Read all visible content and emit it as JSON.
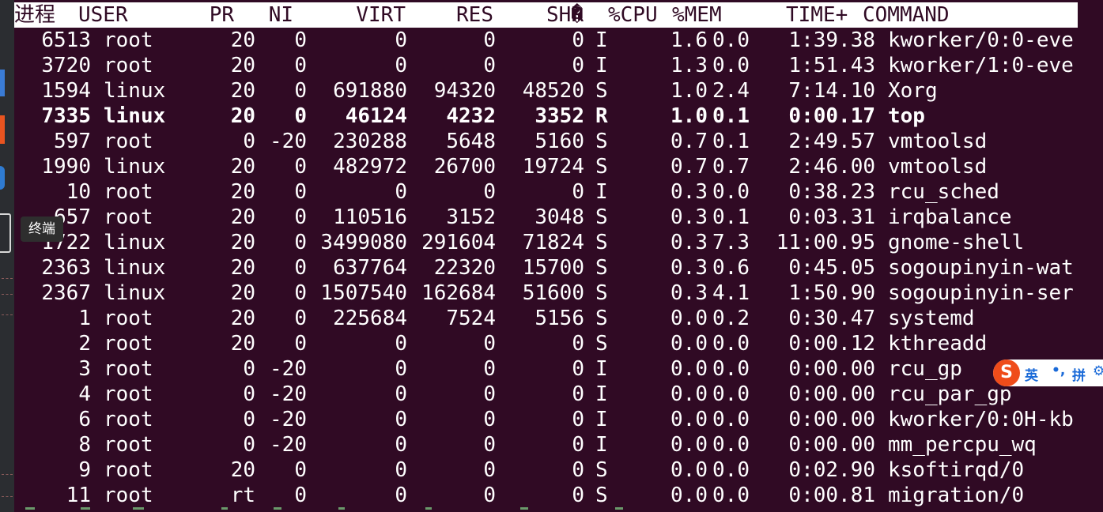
{
  "tooltip": "终端",
  "header": {
    "pid": "进程",
    "user": "USER",
    "pr": "PR",
    "ni": "NI",
    "virt": "VIRT",
    "res": "RES",
    "shr": "SHR",
    "s": "�",
    "cpu": "%CPU",
    "mem": "%MEM",
    "time": "TIME+",
    "command": "COMMAND"
  },
  "processes": [
    {
      "pid": "6513",
      "user": "root",
      "pr": "20",
      "ni": "0",
      "virt": "0",
      "res": "0",
      "shr": "0",
      "s": "I",
      "cpu": "1.6",
      "mem": "0.0",
      "time": "1:39.38",
      "command": "kworker/0:0-eve"
    },
    {
      "pid": "3720",
      "user": "root",
      "pr": "20",
      "ni": "0",
      "virt": "0",
      "res": "0",
      "shr": "0",
      "s": "I",
      "cpu": "1.3",
      "mem": "0.0",
      "time": "1:51.43",
      "command": "kworker/1:0-eve"
    },
    {
      "pid": "1594",
      "user": "linux",
      "pr": "20",
      "ni": "0",
      "virt": "691880",
      "res": "94320",
      "shr": "48520",
      "s": "S",
      "cpu": "1.0",
      "mem": "2.4",
      "time": "7:14.10",
      "command": "Xorg"
    },
    {
      "pid": "7335",
      "user": "linux",
      "pr": "20",
      "ni": "0",
      "virt": "46124",
      "res": "4232",
      "shr": "3352",
      "s": "R",
      "cpu": "1.0",
      "mem": "0.1",
      "time": "0:00.17",
      "command": "top"
    },
    {
      "pid": "597",
      "user": "root",
      "pr": "0",
      "ni": "-20",
      "virt": "230288",
      "res": "5648",
      "shr": "5160",
      "s": "S",
      "cpu": "0.7",
      "mem": "0.1",
      "time": "2:49.57",
      "command": "vmtoolsd"
    },
    {
      "pid": "1990",
      "user": "linux",
      "pr": "20",
      "ni": "0",
      "virt": "482972",
      "res": "26700",
      "shr": "19724",
      "s": "S",
      "cpu": "0.7",
      "mem": "0.7",
      "time": "2:46.00",
      "command": "vmtoolsd"
    },
    {
      "pid": "10",
      "user": "root",
      "pr": "20",
      "ni": "0",
      "virt": "0",
      "res": "0",
      "shr": "0",
      "s": "I",
      "cpu": "0.3",
      "mem": "0.0",
      "time": "0:38.23",
      "command": "rcu_sched"
    },
    {
      "pid": "657",
      "user": "root",
      "pr": "20",
      "ni": "0",
      "virt": "110516",
      "res": "3152",
      "shr": "3048",
      "s": "S",
      "cpu": "0.3",
      "mem": "0.1",
      "time": "0:03.31",
      "command": "irqbalance"
    },
    {
      "pid": "1722",
      "user": "linux",
      "pr": "20",
      "ni": "0",
      "virt": "3499080",
      "res": "291604",
      "shr": "71824",
      "s": "S",
      "cpu": "0.3",
      "mem": "7.3",
      "time": "11:00.95",
      "command": "gnome-shell"
    },
    {
      "pid": "2363",
      "user": "linux",
      "pr": "20",
      "ni": "0",
      "virt": "637764",
      "res": "22320",
      "shr": "15700",
      "s": "S",
      "cpu": "0.3",
      "mem": "0.6",
      "time": "0:45.05",
      "command": "sogoupinyin-wat"
    },
    {
      "pid": "2367",
      "user": "linux",
      "pr": "20",
      "ni": "0",
      "virt": "1507540",
      "res": "162684",
      "shr": "51600",
      "s": "S",
      "cpu": "0.3",
      "mem": "4.1",
      "time": "1:50.90",
      "command": "sogoupinyin-ser"
    },
    {
      "pid": "1",
      "user": "root",
      "pr": "20",
      "ni": "0",
      "virt": "225684",
      "res": "7524",
      "shr": "5156",
      "s": "S",
      "cpu": "0.0",
      "mem": "0.2",
      "time": "0:30.47",
      "command": "systemd"
    },
    {
      "pid": "2",
      "user": "root",
      "pr": "20",
      "ni": "0",
      "virt": "0",
      "res": "0",
      "shr": "0",
      "s": "S",
      "cpu": "0.0",
      "mem": "0.0",
      "time": "0:00.12",
      "command": "kthreadd"
    },
    {
      "pid": "3",
      "user": "root",
      "pr": "0",
      "ni": "-20",
      "virt": "0",
      "res": "0",
      "shr": "0",
      "s": "I",
      "cpu": "0.0",
      "mem": "0.0",
      "time": "0:00.00",
      "command": "rcu_gp"
    },
    {
      "pid": "4",
      "user": "root",
      "pr": "0",
      "ni": "-20",
      "virt": "0",
      "res": "0",
      "shr": "0",
      "s": "I",
      "cpu": "0.0",
      "mem": "0.0",
      "time": "0:00.00",
      "command": "rcu_par_gp"
    },
    {
      "pid": "6",
      "user": "root",
      "pr": "0",
      "ni": "-20",
      "virt": "0",
      "res": "0",
      "shr": "0",
      "s": "I",
      "cpu": "0.0",
      "mem": "0.0",
      "time": "0:00.00",
      "command": "kworker/0:0H-kb"
    },
    {
      "pid": "8",
      "user": "root",
      "pr": "0",
      "ni": "-20",
      "virt": "0",
      "res": "0",
      "shr": "0",
      "s": "I",
      "cpu": "0.0",
      "mem": "0.0",
      "time": "0:00.00",
      "command": "mm_percpu_wq"
    },
    {
      "pid": "9",
      "user": "root",
      "pr": "20",
      "ni": "0",
      "virt": "0",
      "res": "0",
      "shr": "0",
      "s": "S",
      "cpu": "0.0",
      "mem": "0.0",
      "time": "0:02.90",
      "command": "ksoftirqd/0"
    },
    {
      "pid": "11",
      "user": "root",
      "pr": "rt",
      "ni": "0",
      "virt": "0",
      "res": "0",
      "shr": "0",
      "s": "S",
      "cpu": "0.0",
      "mem": "0.0",
      "time": "0:00.81",
      "command": "migration/0"
    }
  ],
  "bold_row_index": 3,
  "ime": {
    "logo": "S",
    "mode": "英",
    "punct": "•,",
    "pinyin": "拼",
    "settings_icon": "gear-icon"
  },
  "colors": {
    "terminal_bg": "#300a24",
    "text": "#ffffff",
    "header_bg": "#ffffff",
    "header_text": "#300a24",
    "ime_logo": "#ef4c1a",
    "ime_text": "#1a6ad8"
  }
}
